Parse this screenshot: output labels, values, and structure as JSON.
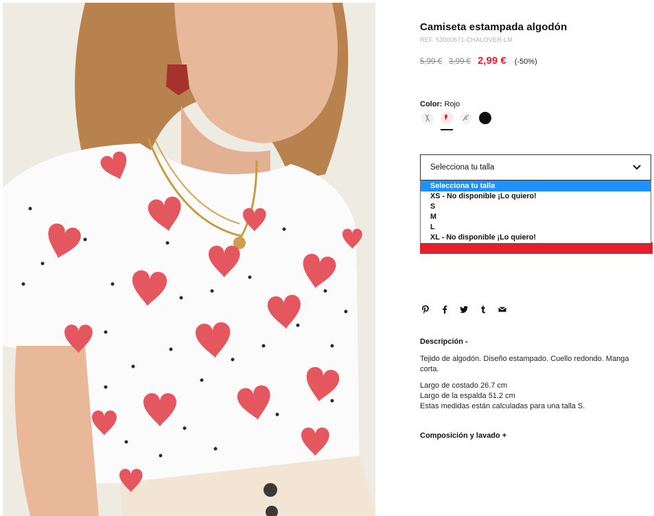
{
  "product": {
    "title": "Camiseta estampada algodón",
    "ref": "REF. 53000671-CHALOVER-LM",
    "price_original": "5,99 €",
    "price_previous": "3,99 €",
    "price_current": "2,99 €",
    "discount": "(-50%)"
  },
  "color": {
    "label": "Color:",
    "selected": "Rojo",
    "swatches": [
      {
        "name": "light-print",
        "color": "#f4f4f4"
      },
      {
        "name": "red-heart",
        "color": "#e5202e"
      },
      {
        "name": "leaf-print",
        "color": "#f3f3f3"
      },
      {
        "name": "black",
        "color": "#111111"
      }
    ]
  },
  "size_select": {
    "placeholder": "Selecciona tu talla",
    "options": [
      "Selecciona tu talla",
      "XS - No disponible ¡Lo quiero!",
      "S",
      "M",
      "L",
      "XL - No disponible ¡Lo quiero!"
    ],
    "highlighted_index": 0
  },
  "share_icons": [
    "pinterest-icon",
    "facebook-icon",
    "twitter-icon",
    "tumblr-icon",
    "email-icon"
  ],
  "description": {
    "title": "Descripción -",
    "text": "Tejido de algodón. Diseño estampado. Cuello redondo. Manga corta.",
    "measures": [
      "Largo de costado 26.7 cm",
      "Largo de la espalda 51.2 cm",
      "Estas medidas están calculadas para una talla S."
    ]
  },
  "composition": {
    "title": "Composición y lavado +"
  },
  "colors": {
    "accent": "#e5202e",
    "highlight": "#1e90ff"
  }
}
